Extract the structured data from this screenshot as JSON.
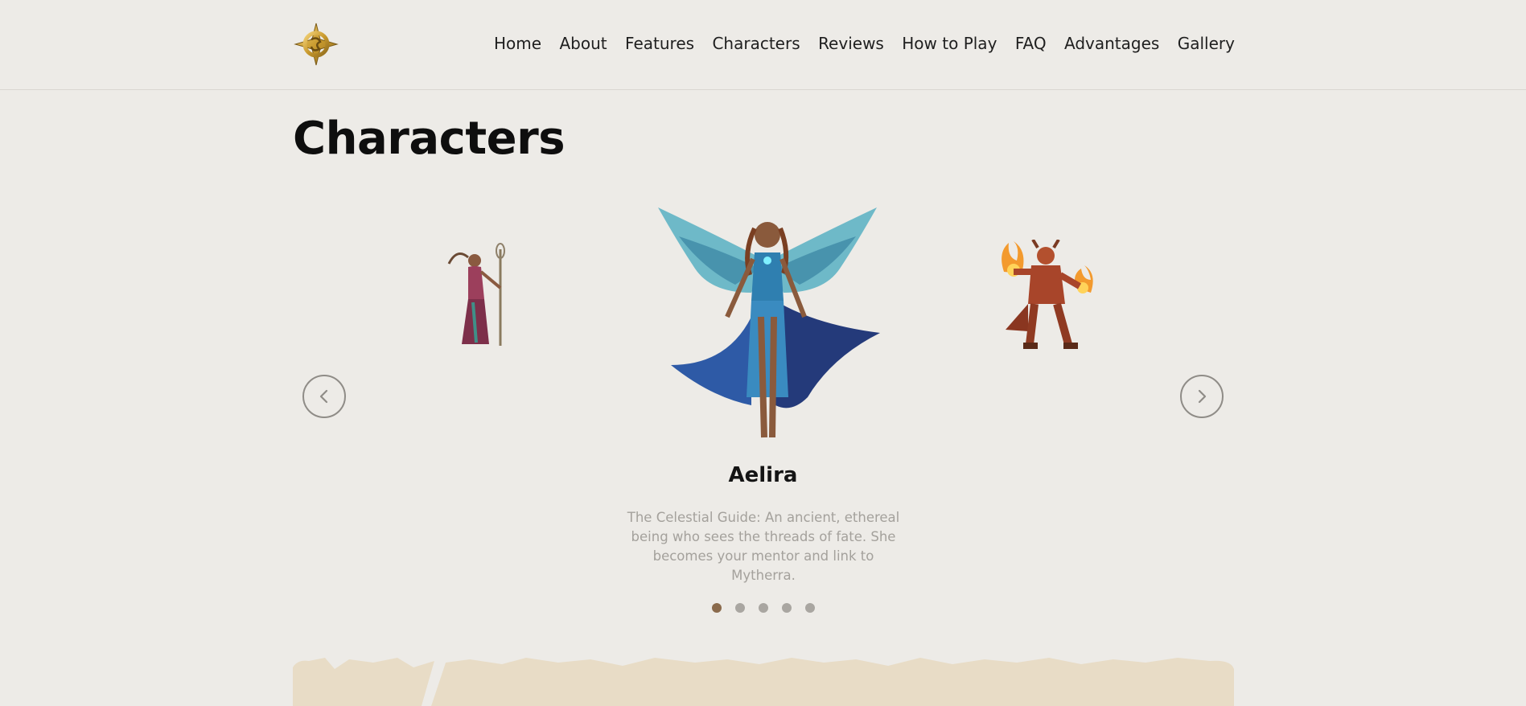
{
  "nav": {
    "logo": "mytherra-logo",
    "items": [
      {
        "label": "Home"
      },
      {
        "label": "About"
      },
      {
        "label": "Features"
      },
      {
        "label": "Characters"
      },
      {
        "label": "Reviews"
      },
      {
        "label": "How to Play"
      },
      {
        "label": "FAQ"
      },
      {
        "label": "Advantages"
      },
      {
        "label": "Gallery"
      }
    ]
  },
  "section": {
    "title": "Characters"
  },
  "carousel": {
    "active_character": {
      "name": "Aelira",
      "description": "The Celestial Guide: An ancient, ethereal being who sees the threads of fate. She becomes your mentor and link to Mytherra."
    },
    "prev_icon": "chevron-left-icon",
    "next_icon": "chevron-right-icon",
    "dot_count": 5,
    "active_dot": 1
  },
  "colors": {
    "background": "#edebe7",
    "accent": "#8a6a4c",
    "banner": "#e8dcc6"
  }
}
